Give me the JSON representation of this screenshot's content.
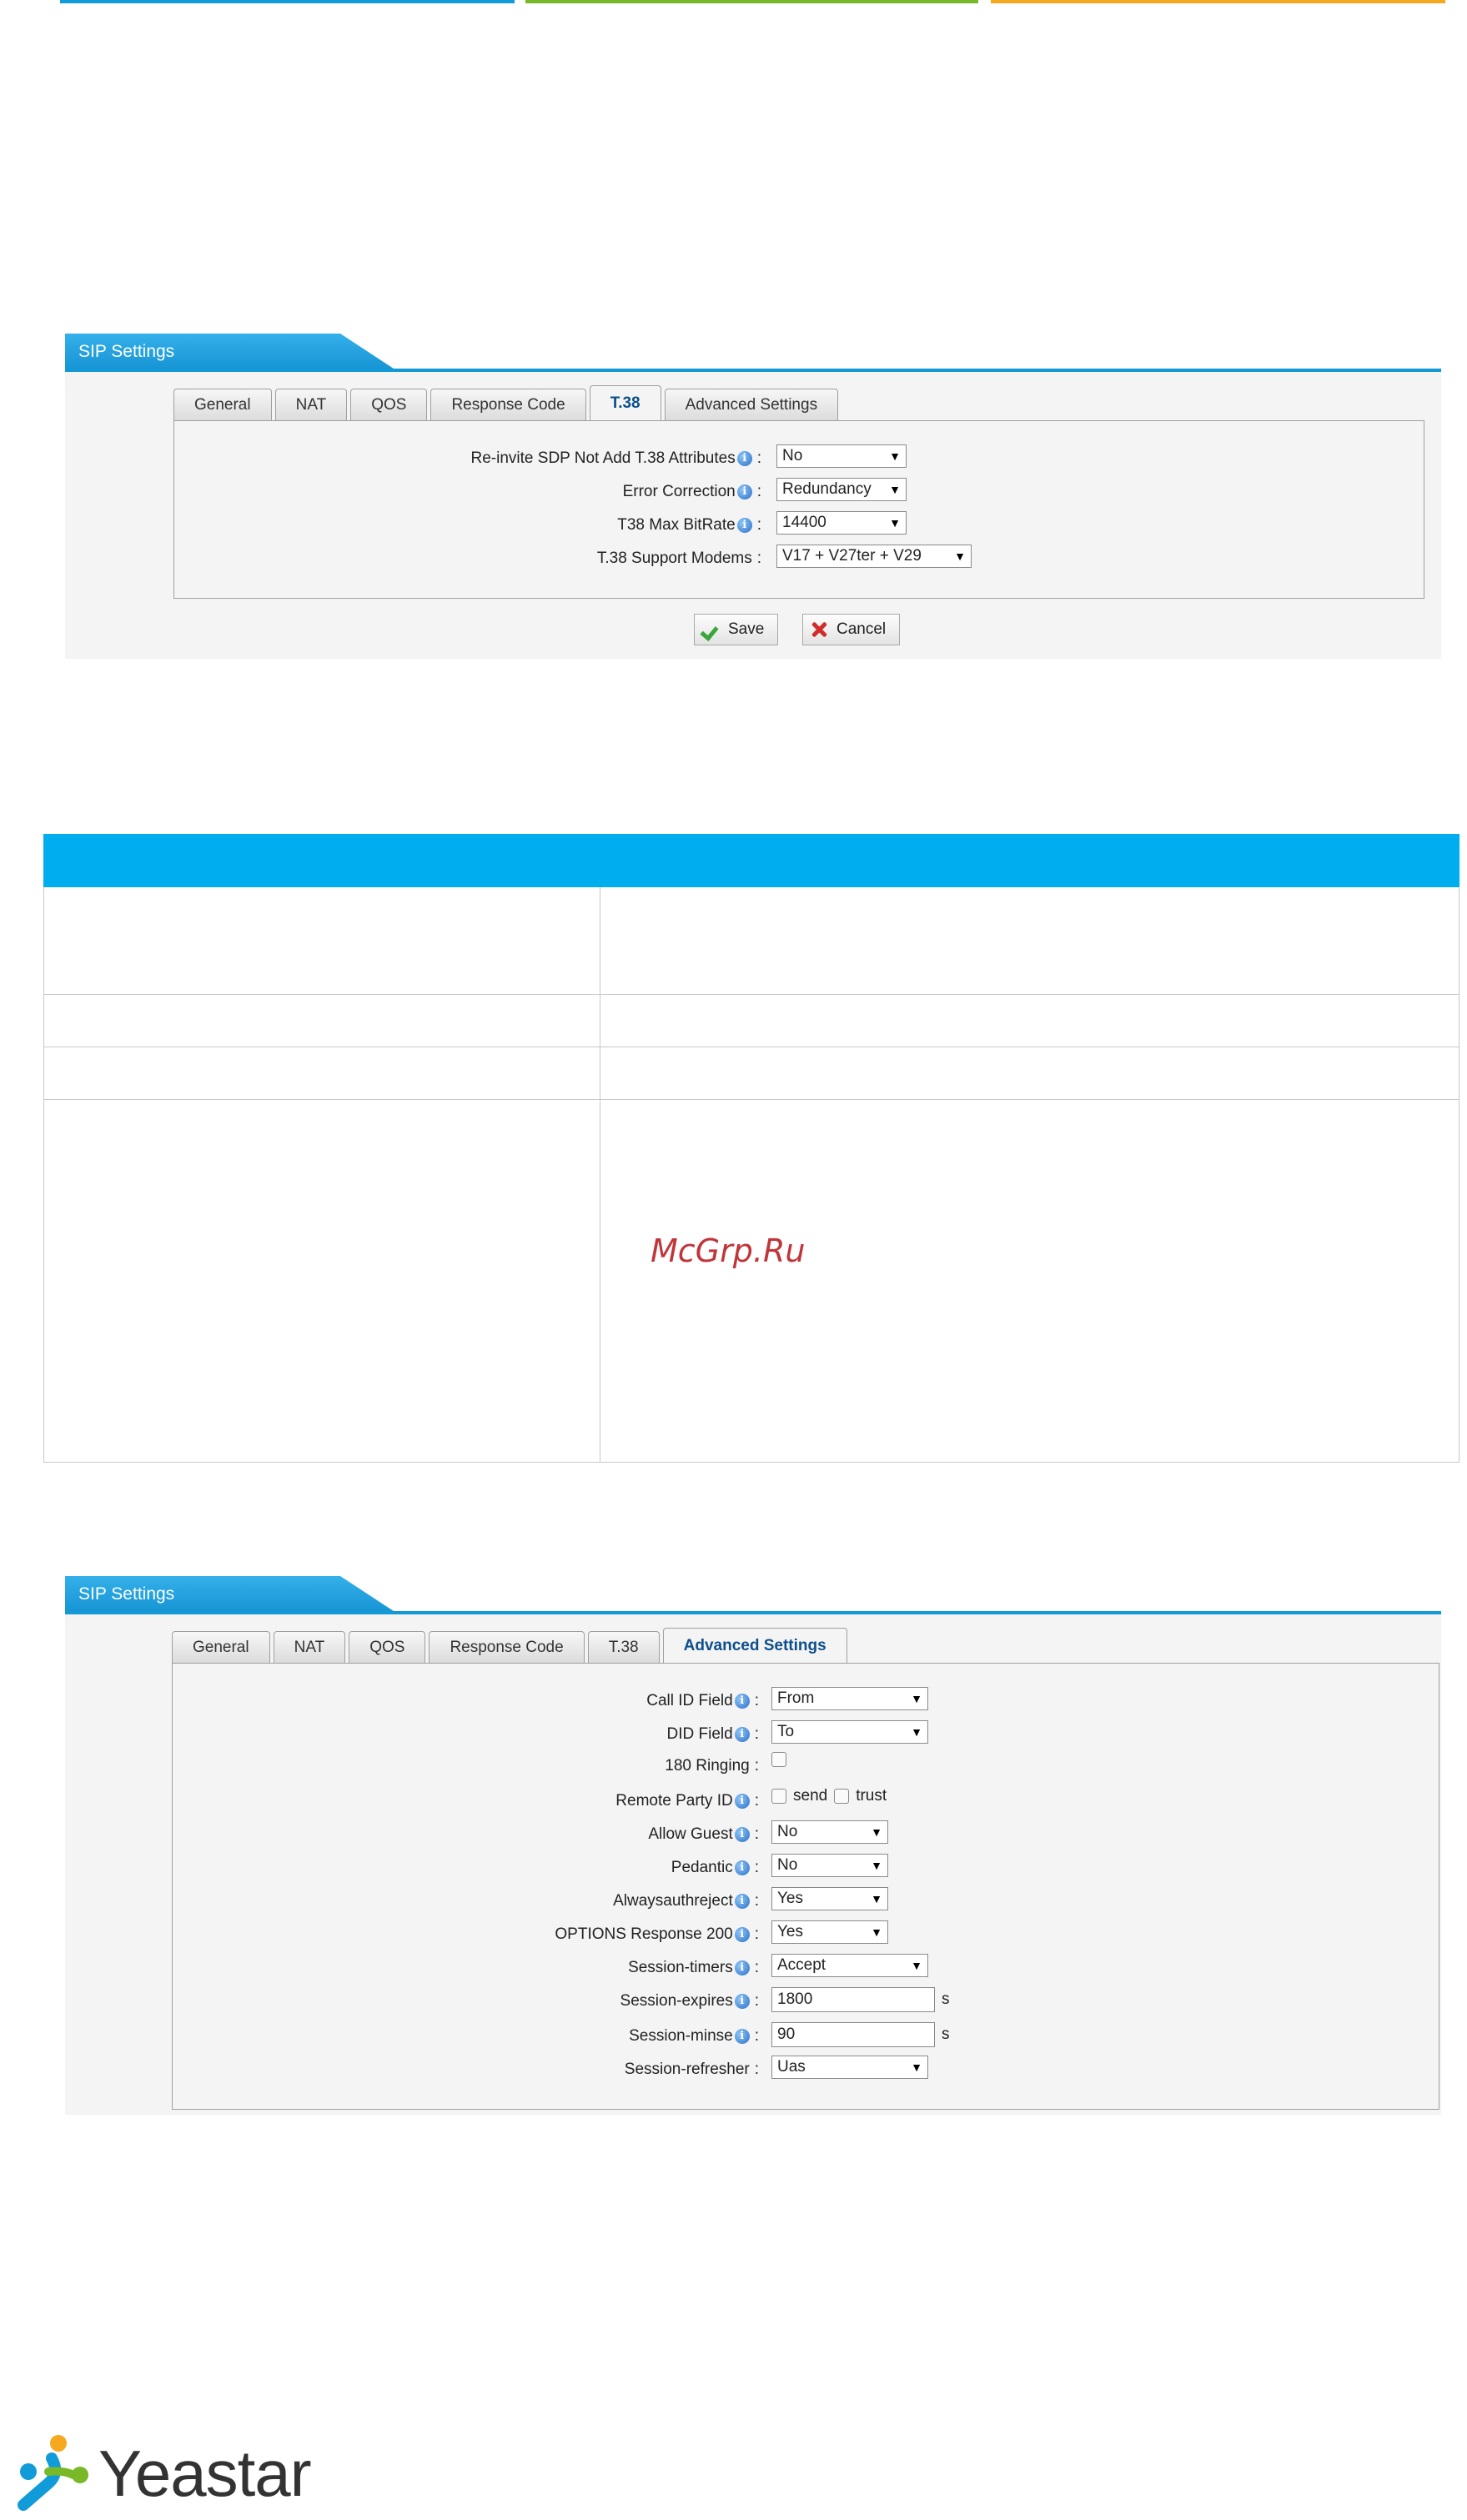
{
  "topbar_colors": [
    "#129bd9",
    "#79b928",
    "#f6a81e"
  ],
  "panel1": {
    "title": "SIP Settings",
    "tabs": [
      "General",
      "NAT",
      "QOS",
      "Response Code",
      "T.38",
      "Advanced Settings"
    ],
    "active_tab": "T.38",
    "fields": [
      {
        "label": "Re-invite SDP Not Add T.38 Attributes",
        "value": "No"
      },
      {
        "label": "Error Correction",
        "value": "Redundancy"
      },
      {
        "label": "T38 Max BitRate",
        "value": "14400"
      },
      {
        "label": "T.38 Support Modems",
        "value": "V17 + V27ter + V29"
      }
    ],
    "save_label": "Save",
    "cancel_label": "Cancel"
  },
  "panel2": {
    "title": "SIP Settings",
    "tabs": [
      "General",
      "NAT",
      "QOS",
      "Response Code",
      "T.38",
      "Advanced Settings"
    ],
    "active_tab": "Advanced Settings",
    "fields": [
      {
        "label": "Call ID Field",
        "value": "From"
      },
      {
        "label": "DID Field",
        "value": "To"
      },
      {
        "label": "180 Ringing"
      },
      {
        "label": "Remote Party ID",
        "send_label": "send",
        "trust_label": "trust"
      },
      {
        "label": "Allow Guest",
        "value": "No"
      },
      {
        "label": "Pedantic",
        "value": "No"
      },
      {
        "label": "Alwaysauthreject",
        "value": "Yes"
      },
      {
        "label": "OPTIONS Response 200",
        "value": "Yes"
      },
      {
        "label": "Session-timers",
        "value": "Accept"
      },
      {
        "label": "Session-expires",
        "value": "1800",
        "unit": "s"
      },
      {
        "label": "Session-minse",
        "value": "90",
        "unit": "s"
      },
      {
        "label": "Session-refresher",
        "value": "Uas"
      }
    ]
  },
  "watermark": "McGrp.Ru",
  "logo_text": "Yeastar",
  "table_header_color": "#00aeef"
}
